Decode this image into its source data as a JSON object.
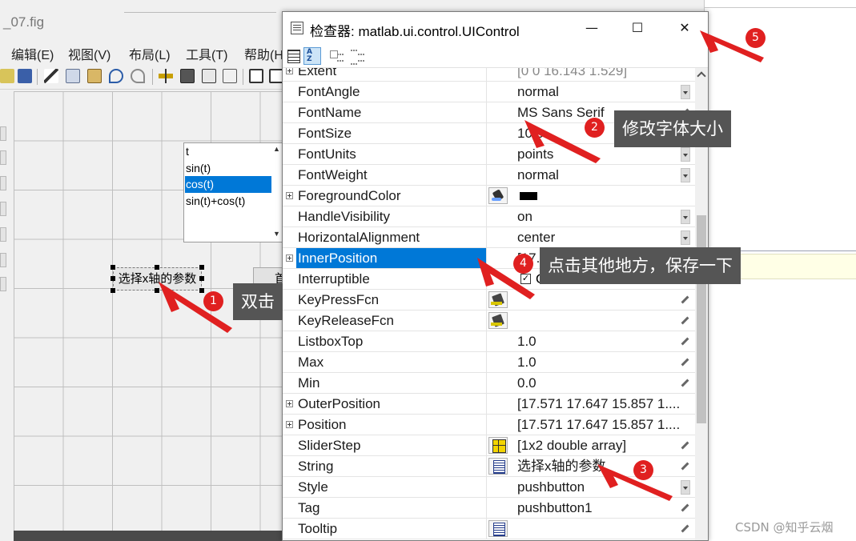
{
  "guide": {
    "title": "_07.fig",
    "menu": [
      "编辑(E)",
      "视图(V)",
      "布局(L)",
      "工具(T)",
      "帮助(H"
    ],
    "listbox_items": [
      "t",
      "sin(t)",
      "cos(t)",
      "sin(t)+cos(t)"
    ],
    "listbox_selected_index": 2,
    "pushbutton_label": "选择x轴的参数",
    "second_button_label": "首"
  },
  "inspector": {
    "title": "检查器:  matlab.ui.control.UIControl",
    "minimize_label": "—",
    "maximize_label": "☐",
    "close_label": "✕",
    "properties": [
      {
        "name": "Extent",
        "value": "[0 0 16.143 1.529]",
        "expand": true,
        "control": "none",
        "dim": true
      },
      {
        "name": "FontAngle",
        "value": "normal",
        "control": "dropdown"
      },
      {
        "name": "FontName",
        "value": "MS Sans Serif",
        "control": "pencil"
      },
      {
        "name": "FontSize",
        "value": "10.0",
        "control": "pencil"
      },
      {
        "name": "FontUnits",
        "value": "points",
        "control": "dropdown"
      },
      {
        "name": "FontWeight",
        "value": "normal",
        "control": "dropdown"
      },
      {
        "name": "ForegroundColor",
        "value": "",
        "expand": true,
        "control": "none",
        "swatch": "#000000",
        "button": "brush"
      },
      {
        "name": "HandleVisibility",
        "value": "on",
        "control": "dropdown"
      },
      {
        "name": "HorizontalAlignment",
        "value": "center",
        "control": "dropdown"
      },
      {
        "name": "InnerPosition",
        "value": "[17.571 17.647 15.857 1.",
        "expand": true,
        "control": "none",
        "selected": true
      },
      {
        "name": "Interruptible",
        "value": "On",
        "control": "none",
        "checkbox": true
      },
      {
        "name": "KeyPressFcn",
        "value": "",
        "control": "pencil",
        "button": "func"
      },
      {
        "name": "KeyReleaseFcn",
        "value": "",
        "control": "pencil",
        "button": "func"
      },
      {
        "name": "ListboxTop",
        "value": "1.0",
        "control": "pencil"
      },
      {
        "name": "Max",
        "value": "1.0",
        "control": "pencil"
      },
      {
        "name": "Min",
        "value": "0.0",
        "control": "pencil"
      },
      {
        "name": "OuterPosition",
        "value": "[17.571 17.647 15.857 1....",
        "expand": true,
        "control": "none"
      },
      {
        "name": "Position",
        "value": "[17.571 17.647 15.857 1....",
        "expand": true,
        "control": "none"
      },
      {
        "name": "SliderStep",
        "value": "[1x2  double array]",
        "control": "pencil",
        "button": "grid"
      },
      {
        "name": "String",
        "value": "选择x轴的参数",
        "control": "pencil",
        "button": "text"
      },
      {
        "name": "Style",
        "value": "pushbutton",
        "control": "dropdown"
      },
      {
        "name": "Tag",
        "value": "pushbutton1",
        "control": "pencil"
      },
      {
        "name": "Tooltip",
        "value": "",
        "control": "pencil",
        "button": "text"
      }
    ]
  },
  "annotations": {
    "callout_1": "双击",
    "callout_2": "修改字体大小",
    "callout_4": "点击其他地方，保存一下",
    "badge_1": "1",
    "badge_2": "2",
    "badge_3": "3",
    "badge_4": "4",
    "badge_5": "5",
    "color": "#e02020"
  },
  "watermark": "CSDN @知乎云烟"
}
